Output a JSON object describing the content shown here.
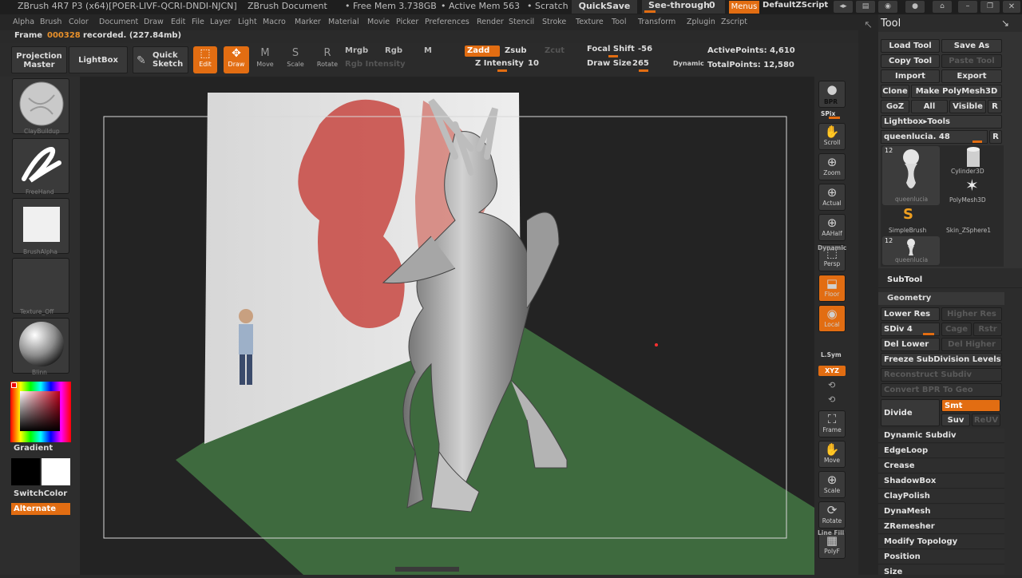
{
  "titlebar": {
    "app_title": "ZBrush 4R7 P3 (x64)[POER-LIVF-QCRI-DNDI-NJCN]",
    "document": "ZBrush Document",
    "free_mem": "• Free Mem 3.738GB",
    "active_mem": "• Active Mem 563",
    "scratch": "• Scratch",
    "quicksave": "QuickSave",
    "see_through": "See-through",
    "see_through_value": "0",
    "menus": "Menus",
    "script": "DefaultZScript"
  },
  "menubar": {
    "items": [
      "Alpha",
      "Brush",
      "Color",
      "Document",
      "Draw",
      "Edit",
      "File",
      "Layer",
      "Light",
      "Macro",
      "Marker",
      "Material",
      "Movie",
      "Picker",
      "Preferences",
      "Render",
      "Stencil",
      "Stroke",
      "Texture",
      "Tool",
      "Transform",
      "Zplugin",
      "Zscript"
    ]
  },
  "status": {
    "frame_label": "Frame",
    "frame_number": "000328",
    "frame_text": "recorded. (227.84mb)"
  },
  "toolbar": {
    "projection_master": "Projection Master",
    "lightbox": "LightBox",
    "quick_sketch": "Quick Sketch",
    "edit": "Edit",
    "draw": "Draw",
    "move": "Move",
    "scale": "Scale",
    "rotate": "Rotate",
    "mrgb": "Mrgb",
    "rgb": "Rgb",
    "m": "M",
    "rgb_intensity": "Rgb Intensity",
    "zadd": "Zadd",
    "zsub": "Zsub",
    "zcut": "Zcut",
    "z_intensity": "Z Intensity",
    "z_intensity_value": "10",
    "focal_shift": "Focal Shift",
    "focal_shift_value": "-56",
    "draw_size": "Draw Size",
    "draw_size_value": "265",
    "dynamic": "Dynamic",
    "active_points": "ActivePoints: 4,610",
    "total_points": "TotalPoints: 12,580"
  },
  "leftshelf": {
    "brush": "ClayBuildup",
    "stroke": "FreeHand",
    "alpha": "BrushAlpha",
    "texture": "Texture_Off",
    "material": "Blinn",
    "gradient": "Gradient",
    "switch_color": "SwitchColor",
    "alternate": "Alternate",
    "colors": {
      "main": "#000000",
      "secondary": "#ffffff"
    }
  },
  "rightshelf": {
    "bpr": "BPR",
    "spix": "SPix",
    "scroll": "Scroll",
    "zoom": "Zoom",
    "actual": "Actual",
    "aahalf": "AAHalf",
    "dynamic": "Dynamic",
    "persp": "Persp",
    "floor": "Floor",
    "local": "Local",
    "lsym": "L.Sym",
    "xyz": "XYZ",
    "frame": "Frame",
    "move": "Move",
    "scale": "Scale",
    "rotate": "Rotate",
    "linefill": "Line Fill",
    "polyf": "PolyF"
  },
  "toolpanel": {
    "title": "Tool",
    "load_tool": "Load Tool",
    "save_as": "Save As",
    "copy_tool": "Copy Tool",
    "paste_tool": "Paste Tool",
    "import": "Import",
    "export": "Export",
    "clone": "Clone",
    "make_polymesh": "Make PolyMesh3D",
    "goz": "GoZ",
    "all": "All",
    "visible": "Visible",
    "r": "R",
    "lightbox_tools": "Lightbox▸Tools",
    "current_tool": "queenlucia. 48",
    "thumbs": [
      {
        "label": "queenlucia",
        "badge": "12"
      },
      {
        "label": "Cylinder3D"
      },
      {
        "label": "PolyMesh3D"
      },
      {
        "label": "SimpleBrush"
      },
      {
        "label": "Skin_ZSphere1"
      },
      {
        "label": "queenlucia",
        "badge": "12"
      }
    ],
    "subtool": "SubTool",
    "geometry": "Geometry",
    "lower_res": "Lower Res",
    "higher_res": "Higher Res",
    "sdiv": "SDiv 4",
    "cage": "Cage",
    "rstr": "Rstr",
    "del_lower": "Del Lower",
    "del_higher": "Del Higher",
    "freeze": "Freeze SubDivision Levels",
    "reconstruct": "Reconstruct Subdiv",
    "convert_bpr": "Convert BPR To Geo",
    "divide": "Divide",
    "smt": "Smt",
    "suv": "Suv",
    "reuv": "ReUV",
    "sections": [
      "Dynamic Subdiv",
      "EdgeLoop",
      "Crease",
      "ShadowBox",
      "ClayPolish",
      "DynaMesh",
      "ZRemesher",
      "Modify Topology",
      "Position",
      "Size"
    ]
  }
}
